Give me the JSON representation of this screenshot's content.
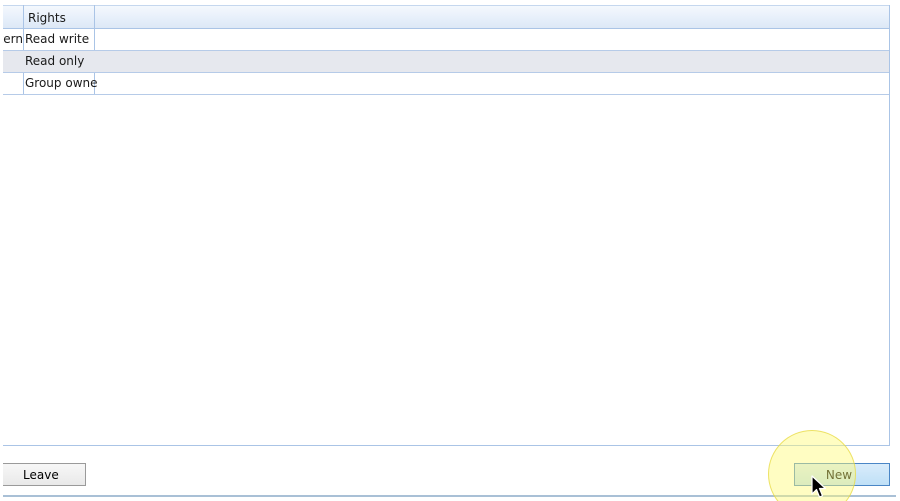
{
  "grid": {
    "columns": [
      {
        "label": ""
      },
      {
        "label": "Rights"
      }
    ],
    "rows": [
      {
        "partial_cell": "tern",
        "rights": "Read write"
      },
      {
        "partial_cell": "",
        "rights": "Read only"
      },
      {
        "partial_cell": "",
        "rights": "Group owner"
      }
    ]
  },
  "buttons": {
    "leave_label": "Leave",
    "new_label": "New"
  },
  "colors": {
    "grid_border": "#aac4e6",
    "alt_row": "#e6e8ee",
    "new_button": "#bfe0f7",
    "cursor_highlight": "#fffa78"
  },
  "icons": {
    "cursor": "mouse-pointer-icon"
  }
}
